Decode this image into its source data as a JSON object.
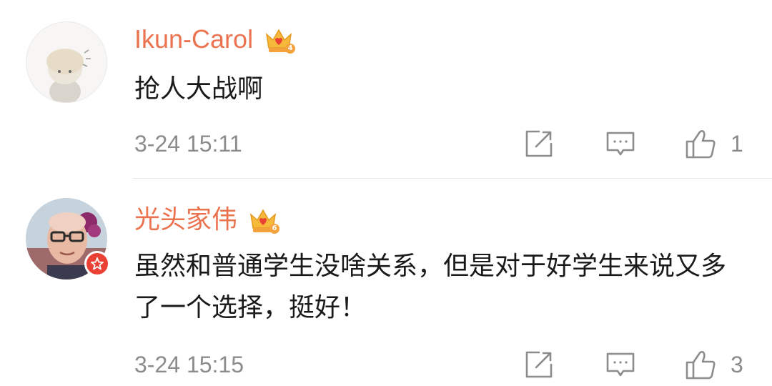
{
  "comments": [
    {
      "username": "Ikun-Carol",
      "crown_level": "4",
      "text": "抢人大战啊",
      "time": "3-24 15:11",
      "likes": "1",
      "icons": {
        "avatar": "cartoon-avatar",
        "crown": "vip-crown-icon",
        "share": "share-icon",
        "reply": "comment-icon",
        "like": "thumbs-up-icon"
      }
    },
    {
      "username": "光头家伟",
      "crown_level": "6",
      "text": "虽然和普通学生没啥关系，但是对于好学生来说又多了一个选择，挺好！",
      "time": "3-24 15:15",
      "likes": "3",
      "verified": true,
      "icons": {
        "avatar": "photo-avatar",
        "crown": "vip-crown-icon",
        "badge": "verified-star-icon",
        "share": "share-icon",
        "reply": "comment-icon",
        "like": "thumbs-up-icon"
      }
    }
  ],
  "colors": {
    "username": "#eb7350",
    "text": "#1a1a1a",
    "meta": "#8c8c8c",
    "crown": "#f6b93b",
    "badge": "#e94235",
    "divider": "#e6e6e6"
  }
}
